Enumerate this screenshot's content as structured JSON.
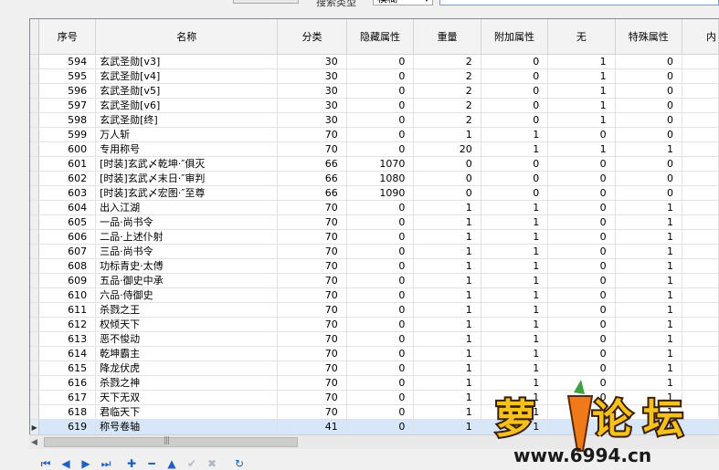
{
  "toolbar": {
    "search_label": "搜索类型",
    "search_type_value": "模糊",
    "search_value": ""
  },
  "columns": [
    "序号",
    "名称",
    "分类",
    "隐藏属性",
    "重量",
    "附加属性",
    "无",
    "特殊属性",
    "内"
  ],
  "rows": [
    {
      "id": "594",
      "name": "玄武圣勋[v3]",
      "cat": "30",
      "hidden": "0",
      "weight": "2",
      "extra": "0",
      "none": "1",
      "special": "0"
    },
    {
      "id": "595",
      "name": "玄武圣勋[v4]",
      "cat": "30",
      "hidden": "0",
      "weight": "2",
      "extra": "0",
      "none": "1",
      "special": "0"
    },
    {
      "id": "596",
      "name": "玄武圣勋[v5]",
      "cat": "30",
      "hidden": "0",
      "weight": "2",
      "extra": "0",
      "none": "1",
      "special": "0"
    },
    {
      "id": "597",
      "name": "玄武圣勋[v6]",
      "cat": "30",
      "hidden": "0",
      "weight": "2",
      "extra": "0",
      "none": "1",
      "special": "0"
    },
    {
      "id": "598",
      "name": "玄武圣勋[终]",
      "cat": "30",
      "hidden": "0",
      "weight": "2",
      "extra": "0",
      "none": "1",
      "special": "0"
    },
    {
      "id": "599",
      "name": "万人斩",
      "cat": "70",
      "hidden": "0",
      "weight": "1",
      "extra": "1",
      "none": "0",
      "special": "0"
    },
    {
      "id": "600",
      "name": "专用称号",
      "cat": "70",
      "hidden": "0",
      "weight": "20",
      "extra": "1",
      "none": "1",
      "special": "1"
    },
    {
      "id": "601",
      "name": "[时装]玄武〆乾坤·″俱灭",
      "cat": "66",
      "hidden": "1070",
      "weight": "0",
      "extra": "0",
      "none": "0",
      "special": "0"
    },
    {
      "id": "602",
      "name": "[时装]玄武〆末日·″审判",
      "cat": "66",
      "hidden": "1080",
      "weight": "0",
      "extra": "0",
      "none": "0",
      "special": "0"
    },
    {
      "id": "603",
      "name": "[时装]玄武〆宏图·″至尊",
      "cat": "66",
      "hidden": "1090",
      "weight": "0",
      "extra": "0",
      "none": "0",
      "special": "0"
    },
    {
      "id": "604",
      "name": "出入江湖",
      "cat": "70",
      "hidden": "0",
      "weight": "1",
      "extra": "1",
      "none": "0",
      "special": "1"
    },
    {
      "id": "605",
      "name": "一品·尚书令",
      "cat": "70",
      "hidden": "0",
      "weight": "1",
      "extra": "1",
      "none": "0",
      "special": "1"
    },
    {
      "id": "606",
      "name": "二品·上述仆射",
      "cat": "70",
      "hidden": "0",
      "weight": "1",
      "extra": "1",
      "none": "0",
      "special": "1"
    },
    {
      "id": "607",
      "name": "三品·尚书令",
      "cat": "70",
      "hidden": "0",
      "weight": "1",
      "extra": "1",
      "none": "0",
      "special": "1"
    },
    {
      "id": "608",
      "name": "功标青史·太傅",
      "cat": "70",
      "hidden": "0",
      "weight": "1",
      "extra": "1",
      "none": "0",
      "special": "1"
    },
    {
      "id": "609",
      "name": "五品·御史中承",
      "cat": "70",
      "hidden": "0",
      "weight": "1",
      "extra": "1",
      "none": "0",
      "special": "1"
    },
    {
      "id": "610",
      "name": "六品·侍御史",
      "cat": "70",
      "hidden": "0",
      "weight": "1",
      "extra": "1",
      "none": "0",
      "special": "1"
    },
    {
      "id": "611",
      "name": "杀戮之王",
      "cat": "70",
      "hidden": "0",
      "weight": "1",
      "extra": "1",
      "none": "0",
      "special": "1"
    },
    {
      "id": "612",
      "name": "权倾天下",
      "cat": "70",
      "hidden": "0",
      "weight": "1",
      "extra": "1",
      "none": "0",
      "special": "1"
    },
    {
      "id": "613",
      "name": "恶不悛动",
      "cat": "70",
      "hidden": "0",
      "weight": "1",
      "extra": "1",
      "none": "0",
      "special": "1"
    },
    {
      "id": "614",
      "name": "乾坤霸主",
      "cat": "70",
      "hidden": "0",
      "weight": "1",
      "extra": "1",
      "none": "0",
      "special": "1"
    },
    {
      "id": "615",
      "name": "降龙伏虎",
      "cat": "70",
      "hidden": "0",
      "weight": "1",
      "extra": "1",
      "none": "0",
      "special": "1"
    },
    {
      "id": "616",
      "name": "杀戮之神",
      "cat": "70",
      "hidden": "0",
      "weight": "1",
      "extra": "1",
      "none": "0",
      "special": "1"
    },
    {
      "id": "617",
      "name": "天下无双",
      "cat": "70",
      "hidden": "0",
      "weight": "1",
      "extra": "1",
      "none": "0",
      "special": "1"
    },
    {
      "id": "618",
      "name": "君临天下",
      "cat": "70",
      "hidden": "0",
      "weight": "1",
      "extra": "1",
      "none": "0",
      "special": "1"
    },
    {
      "id": "619",
      "name": "称号卷轴",
      "cat": "41",
      "hidden": "0",
      "weight": "1",
      "extra": "1",
      "none": "0",
      "special": "1"
    }
  ],
  "selected_row": "619",
  "watermark": {
    "logo_text": "萝卜论坛",
    "url": "www.6994.cn"
  },
  "colors": {
    "selected_row": "#d7e6f8",
    "nav_icon": "#1f5fbf",
    "grid_line": "#e2e2e2"
  },
  "navigator_icons": [
    "first-icon",
    "prior-icon",
    "next-icon",
    "last-icon",
    "insert-icon",
    "delete-icon",
    "edit-icon",
    "post-icon",
    "cancel-icon",
    "refresh-icon"
  ]
}
